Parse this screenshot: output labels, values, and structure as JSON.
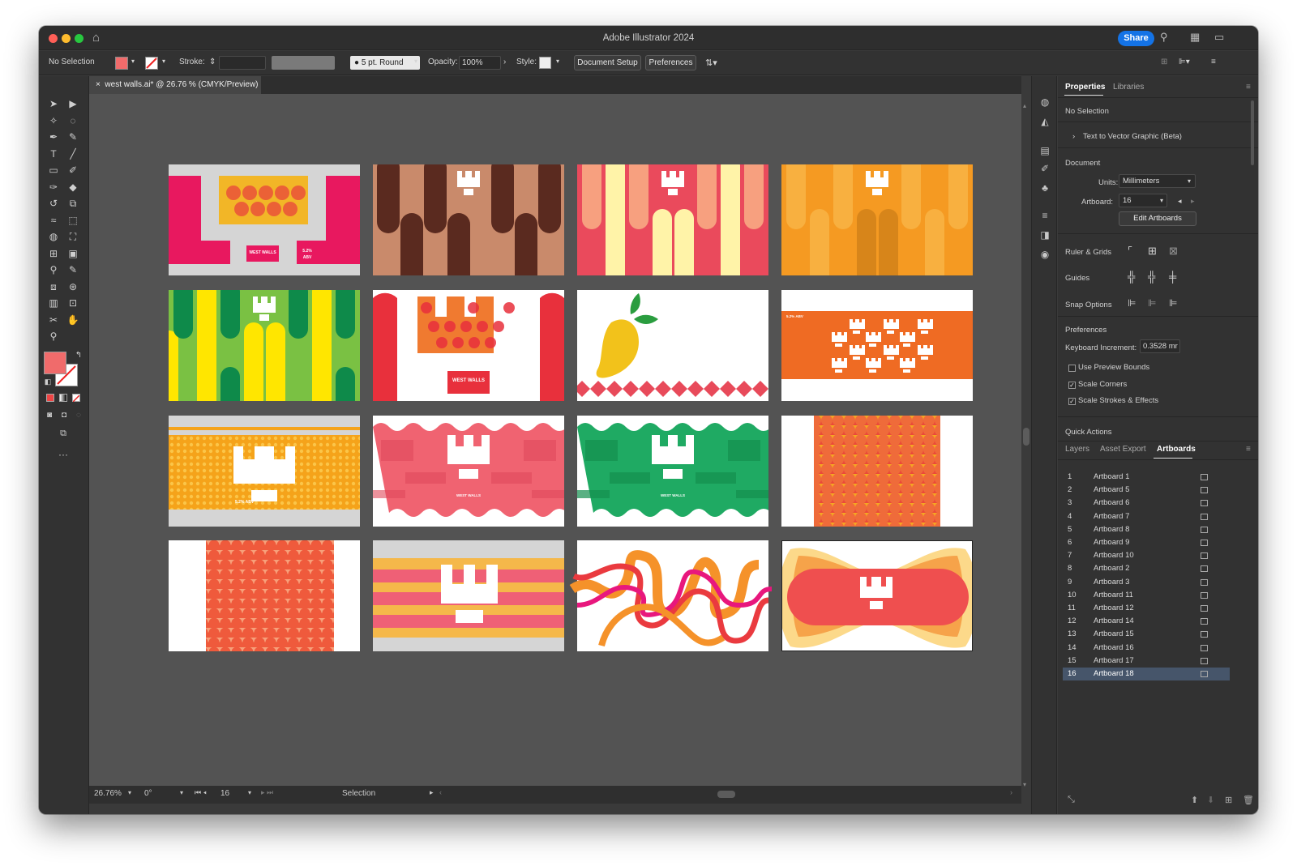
{
  "window": {
    "title": "Adobe Illustrator 2024",
    "share_label": "Share"
  },
  "control_bar": {
    "selection": "No Selection",
    "stroke_label": "Stroke:",
    "brush": "5 pt. Round",
    "opacity_label": "Opacity:",
    "opacity_value": "100%",
    "style_label": "Style:",
    "document_setup": "Document Setup",
    "preferences": "Preferences",
    "fill_color": "#f06b6b"
  },
  "document_tab": {
    "close": "×",
    "title": "west walls.ai* @ 26.76 % (CMYK/Preview)"
  },
  "status_bar": {
    "zoom": "26.76%",
    "rotation": "0°",
    "artboard": "16",
    "tool": "Selection"
  },
  "properties_panel": {
    "tabs": [
      "Properties",
      "Libraries"
    ],
    "no_selection": "No Selection",
    "text_to_vector": "Text to Vector Graphic (Beta)",
    "document_heading": "Document",
    "units_label": "Units:",
    "units_value": "Millimeters",
    "artboard_label": "Artboard:",
    "artboard_value": "16",
    "edit_artboards": "Edit Artboards",
    "ruler_grids": "Ruler & Grids",
    "guides": "Guides",
    "snap_options": "Snap Options",
    "preferences_heading": "Preferences",
    "keyboard_increment_label": "Keyboard Increment:",
    "keyboard_increment_value": "0.3528 mr",
    "use_preview_bounds": "Use Preview Bounds",
    "scale_corners": "Scale Corners",
    "scale_strokes": "Scale Strokes & Effects",
    "quick_actions": "Quick Actions"
  },
  "layers_panel": {
    "tabs": [
      "Layers",
      "Asset Export",
      "Artboards"
    ],
    "selected_index": 15,
    "artboards": [
      {
        "num": "1",
        "name": "Artboard 1"
      },
      {
        "num": "2",
        "name": "Artboard 5"
      },
      {
        "num": "3",
        "name": "Artboard 6"
      },
      {
        "num": "4",
        "name": "Artboard 7"
      },
      {
        "num": "5",
        "name": "Artboard 8"
      },
      {
        "num": "6",
        "name": "Artboard 9"
      },
      {
        "num": "7",
        "name": "Artboard 10"
      },
      {
        "num": "8",
        "name": "Artboard 2"
      },
      {
        "num": "9",
        "name": "Artboard 3"
      },
      {
        "num": "10",
        "name": "Artboard 11"
      },
      {
        "num": "11",
        "name": "Artboard 12"
      },
      {
        "num": "12",
        "name": "Artboard 14"
      },
      {
        "num": "13",
        "name": "Artboard 15"
      },
      {
        "num": "14",
        "name": "Artboard 16"
      },
      {
        "num": "15",
        "name": "Artboard 17"
      },
      {
        "num": "16",
        "name": "Artboard 18"
      }
    ]
  },
  "artwork_text": {
    "brand": "WEST WALLS",
    "abv_short": "5.2% ABV",
    "abv_52": "5.2%",
    "abv_abv": "ABV"
  },
  "colors": {
    "accent": "#1473e6",
    "canvas": "#535353",
    "panel": "#323232"
  }
}
